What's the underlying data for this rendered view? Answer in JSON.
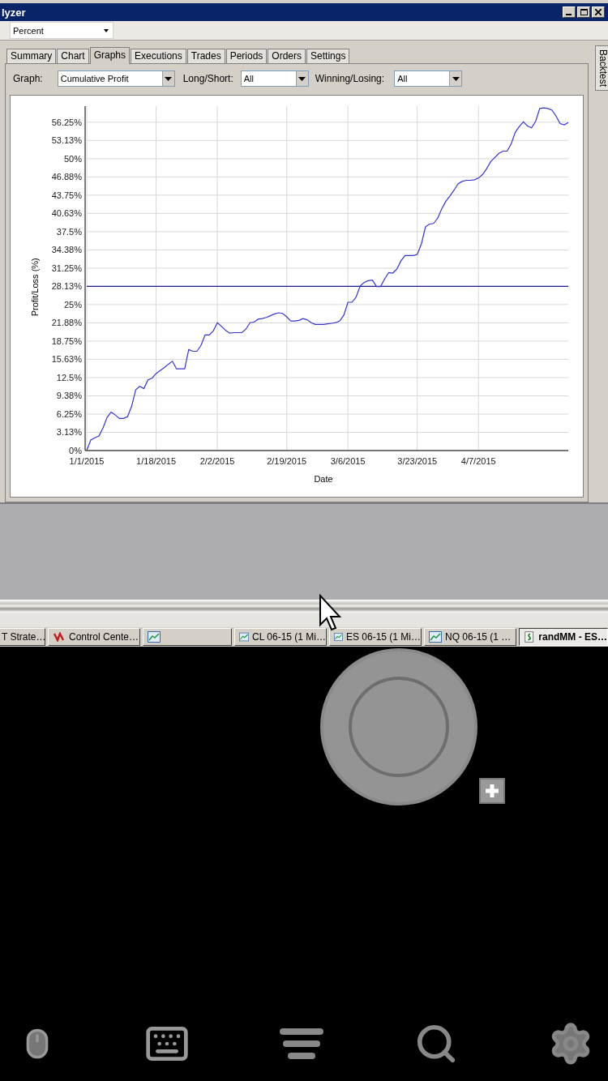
{
  "window": {
    "title": "lyzer"
  },
  "toolbar": {
    "unit": "Percent"
  },
  "tabs": [
    {
      "label": "Summary",
      "selected": false
    },
    {
      "label": "Chart",
      "selected": false
    },
    {
      "label": "Graphs",
      "selected": true
    },
    {
      "label": "Executions",
      "selected": false
    },
    {
      "label": "Trades",
      "selected": false
    },
    {
      "label": "Periods",
      "selected": false
    },
    {
      "label": "Orders",
      "selected": false
    },
    {
      "label": "Settings",
      "selected": false
    }
  ],
  "side_tab": {
    "label": "Backtest"
  },
  "filters": [
    {
      "label": "Graph:",
      "value": "Cumulative Profit"
    },
    {
      "label": "Long/Short:",
      "value": "All"
    },
    {
      "label": "Winning/Losing:",
      "value": "All"
    }
  ],
  "chart": {
    "chart_data": {
      "type": "line",
      "xlabel": "Date",
      "ylabel": "Profit/Loss (%)",
      "ylim": [
        0,
        59
      ],
      "grid": true,
      "categories": [
        "1/1/2015",
        null,
        null,
        null,
        null,
        null,
        null,
        null,
        null,
        null,
        null,
        null,
        null,
        null,
        null,
        null,
        null,
        "1/18/2015",
        null,
        null,
        null,
        null,
        null,
        null,
        null,
        null,
        null,
        null,
        null,
        null,
        null,
        null,
        "2/2/2015",
        null,
        null,
        null,
        null,
        null,
        null,
        null,
        null,
        null,
        null,
        null,
        null,
        null,
        null,
        null,
        null,
        "2/19/2015",
        null,
        null,
        null,
        null,
        null,
        null,
        null,
        null,
        null,
        null,
        null,
        null,
        null,
        null,
        "3/6/2015",
        null,
        null,
        null,
        null,
        null,
        null,
        null,
        null,
        null,
        null,
        null,
        null,
        null,
        null,
        null,
        null,
        "3/23/2015",
        null,
        null,
        null,
        null,
        null,
        null,
        null,
        null,
        null,
        null,
        null,
        null,
        null,
        null,
        "4/7/2015",
        null,
        null,
        null,
        null,
        null,
        null,
        null,
        null,
        null,
        null,
        null,
        null,
        null,
        null,
        null,
        null,
        null,
        null,
        null,
        null,
        null,
        null
      ],
      "yticks": [
        {
          "value": 0,
          "label": "0%"
        },
        {
          "value": 3.125,
          "label": "3.13%"
        },
        {
          "value": 6.25,
          "label": "6.25%"
        },
        {
          "value": 9.375,
          "label": "9.38%"
        },
        {
          "value": 12.5,
          "label": "12.5%"
        },
        {
          "value": 15.625,
          "label": "15.63%"
        },
        {
          "value": 18.75,
          "label": "18.75%"
        },
        {
          "value": 21.875,
          "label": "21.88%"
        },
        {
          "value": 25,
          "label": "25%"
        },
        {
          "value": 28.125,
          "label": "28.13%"
        },
        {
          "value": 31.25,
          "label": "31.25%"
        },
        {
          "value": 34.375,
          "label": "34.38%"
        },
        {
          "value": 37.5,
          "label": "37.5%"
        },
        {
          "value": 40.625,
          "label": "40.63%"
        },
        {
          "value": 43.75,
          "label": "43.75%"
        },
        {
          "value": 46.875,
          "label": "46.88%"
        },
        {
          "value": 50,
          "label": "50%"
        },
        {
          "value": 53.125,
          "label": "53.13%"
        },
        {
          "value": 56.25,
          "label": "56.25%"
        }
      ],
      "series": [
        {
          "color": "#3535d0",
          "values": [
            0,
            1.8,
            2.2,
            2.5,
            3.9,
            5.7,
            6.6,
            6.1,
            5.5,
            5.5,
            5.8,
            7.6,
            10.4,
            11,
            10.6,
            12.1,
            12.4,
            13.2,
            13.7,
            14.2,
            14.8,
            15.3,
            14,
            14,
            14,
            17.3,
            17,
            17,
            18,
            19.8,
            19.8,
            20.5,
            21.9,
            21.3,
            20.6,
            20.1,
            20.2,
            20.2,
            20.2,
            20.8,
            21.9,
            22,
            22.5,
            22.6,
            22.8,
            23.1,
            23.4,
            23.6,
            23.5,
            22.9,
            22.2,
            22.2,
            22.3,
            22.6,
            22.4,
            21.9,
            21.6,
            21.6,
            21.6,
            21.7,
            21.8,
            21.9,
            22.2,
            23.2,
            25.4,
            25.4,
            26.3,
            28.2,
            28.8,
            29.1,
            29.2,
            28.1,
            28.1,
            29.4,
            30.5,
            30.4,
            31.1,
            32.5,
            33.4,
            33.4,
            33.4,
            33.6,
            35.4,
            38.3,
            38.8,
            38.9,
            39.8,
            41.4,
            42.7,
            43.6,
            44.6,
            45.7,
            46.1,
            46.3,
            46.3,
            46.4,
            46.7,
            47.3,
            48.3,
            49.5,
            50.2,
            50.9,
            51.3,
            51.3,
            52.5,
            54.5,
            55.5,
            56.3,
            55.6,
            55.3,
            56.4,
            58.6,
            58.7,
            58.6,
            58.3,
            57.3,
            56,
            55.8,
            56.2
          ]
        }
      ],
      "ref_lines": [
        {
          "axis": "y",
          "value": 28.13
        }
      ]
    }
  },
  "taskbar": [
    {
      "label": "T Strate…",
      "kind": "plain",
      "selected": false
    },
    {
      "label": "Control Cente…",
      "kind": "control",
      "selected": false
    },
    {
      "kind": "chart",
      "selected": false
    },
    {
      "label": "CL 06-15 (1 Mi…",
      "kind": "chart",
      "selected": false
    },
    {
      "label": "ES 06-15 (1 Mi…",
      "kind": "chart",
      "selected": false
    },
    {
      "label": "NQ 06-15 (1 …",
      "kind": "chart",
      "selected": false
    },
    {
      "label": "randMM - ES…",
      "kind": "script",
      "selected": true
    }
  ]
}
